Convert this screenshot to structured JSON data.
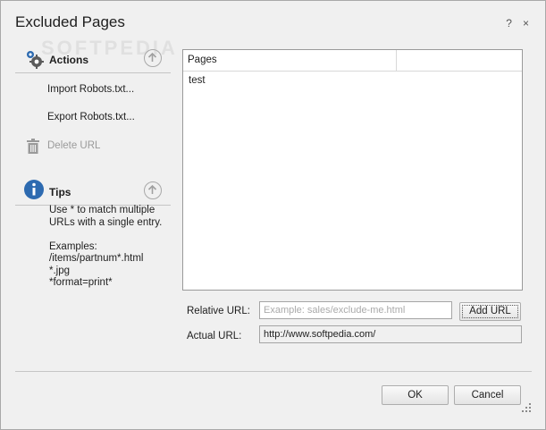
{
  "window": {
    "title": "Excluded Pages",
    "help_label": "?",
    "close_label": "×",
    "watermark": "SOFTPEDIA"
  },
  "actions": {
    "header": "Actions",
    "items": [
      {
        "label": "Import Robots.txt...",
        "enabled": true
      },
      {
        "label": "Export Robots.txt...",
        "enabled": true
      },
      {
        "label": "Delete URL",
        "enabled": false
      }
    ]
  },
  "tips": {
    "header": "Tips",
    "text": "Use * to match multiple\nURLs with a single entry.\n\nExamples:\n/items/partnum*.html\n*.jpg\n*format=print*"
  },
  "pages_list": {
    "column": "Pages",
    "rows": [
      "test"
    ]
  },
  "form": {
    "relative_label": "Relative URL:",
    "relative_placeholder": "Example: sales/exclude-me.html",
    "relative_value": "",
    "add_label": "Add URL",
    "actual_label": "Actual URL:",
    "actual_value": "http://www.softpedia.com/"
  },
  "footer": {
    "ok_label": "OK",
    "cancel_label": "Cancel"
  },
  "colors": {
    "accent_blue": "#2d6ab0",
    "gear_gray": "#5b5b5b"
  },
  "icons": [
    "gears-icon",
    "info-icon",
    "trash-icon",
    "collapse-up-icon",
    "resize-grip-icon"
  ]
}
